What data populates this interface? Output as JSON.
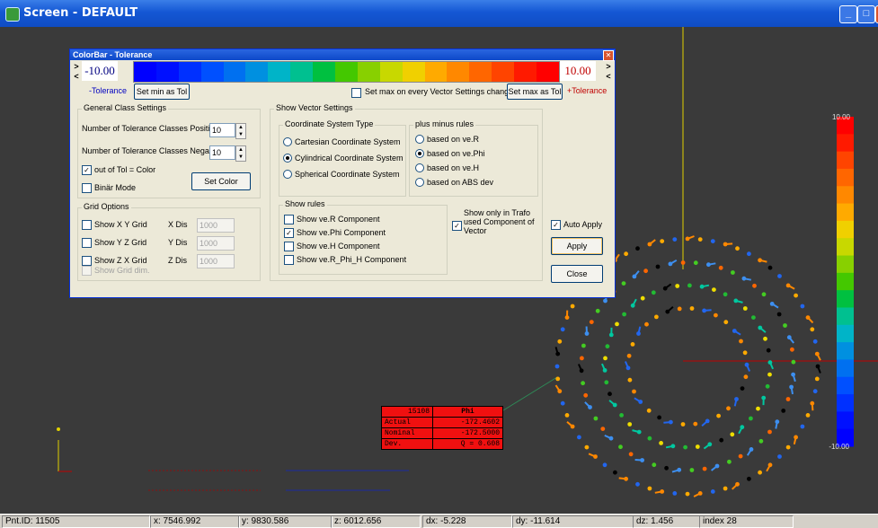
{
  "window": {
    "title": "Screen - DEFAULT"
  },
  "colors": {
    "titlebar": "#1457d4",
    "scene_bg": "#3a3a3a",
    "ring_cycle": [
      "#ff8800",
      "#22bb33",
      "#3d8ff0",
      "#ffaa00",
      "#00c8a0",
      "#ff6600",
      "#2266ee",
      "#eedd00",
      "#44cc22"
    ]
  },
  "scale_bar": {
    "max_label": "10.00",
    "min_label": "-10.00",
    "color_steps": [
      "#ff0000",
      "#ff1a00",
      "#ff4400",
      "#ff6600",
      "#ff8800",
      "#ffaa00",
      "#f0d000",
      "#c8d800",
      "#88d000",
      "#44c800",
      "#00c040",
      "#00c090",
      "#00b4c8",
      "#0090e0",
      "#0070f0",
      "#0050ff",
      "#0030ff",
      "#0010ff",
      "#0000ff"
    ]
  },
  "dialog": {
    "title": "ColorBar - Tolerance",
    "close_glyph": "✕",
    "min_value": "-10.00",
    "max_value": "10.00",
    "minus_tolerance": "-Tolerance",
    "plus_tolerance": "+Tolerance",
    "set_min_btn": "Set min as Tol",
    "set_max_btn": "Set max as Tol",
    "set_max_every": "Set max on every Vector Settings change",
    "gradient": [
      "#0000ff",
      "#0010ff",
      "#0030ff",
      "#0050ff",
      "#0070f0",
      "#0090e0",
      "#00b4c8",
      "#00c090",
      "#00c040",
      "#44c800",
      "#88d000",
      "#c8d800",
      "#f0d000",
      "#ffaa00",
      "#ff8800",
      "#ff6600",
      "#ff4400",
      "#ff1a00",
      "#ff0000"
    ],
    "general": {
      "legend": "General Class Settings",
      "pos_label": "Number of Tolerance Classes Positiv",
      "pos_value": "10",
      "neg_label": "Number of Tolerance Classes Negativ",
      "neg_value": "10",
      "out_of_tol": "out of Tol = Color",
      "binar": "Binär Mode",
      "set_color": "Set Color"
    },
    "grid": {
      "legend": "Grid Options",
      "rows": [
        {
          "label": "Show X Y Grid",
          "dis": "X Dis",
          "value": "1000"
        },
        {
          "label": "Show Y Z Grid",
          "dis": "Y Dis",
          "value": "1000"
        },
        {
          "label": "Show Z X Grid",
          "dis": "Z Dis",
          "value": "1000"
        }
      ],
      "dim": "Show Grid dim."
    },
    "vector": {
      "legend": "Show Vector Settings",
      "coord_legend": "Coordinate System Type",
      "coord": [
        "Cartesian Coordinate System",
        "Cylindrical Coordinate System",
        "Spherical Coordinate System"
      ],
      "pm_legend": "plus minus rules",
      "pm": [
        "based on ve.R",
        "based on ve.Phi",
        "based on ve.H",
        "based on ABS dev"
      ],
      "rules_legend": "Show rules",
      "rules": [
        "Show ve.R Component",
        "Show ve.Phi Component",
        "Show ve.H Component",
        "Show ve.R_Phi_H Component"
      ],
      "trafo": "Show only in Trafo used Component of Vector"
    },
    "auto_apply": "Auto Apply",
    "apply": "Apply",
    "close": "Close"
  },
  "info_table": {
    "header": [
      "15108",
      "Phi"
    ],
    "rows": [
      [
        "Actual",
        "-172.4602"
      ],
      [
        "Nominal",
        "-172.5000"
      ],
      [
        "Dev.",
        "Q = 0.608"
      ]
    ]
  },
  "status": [
    "Pnt.ID: 11505",
    "x: 7546.992",
    "y: 9830.586",
    "z: 6012.656",
    "dx: -5.228",
    "dy: -11.614",
    "dz: 1.456",
    "index 28"
  ]
}
